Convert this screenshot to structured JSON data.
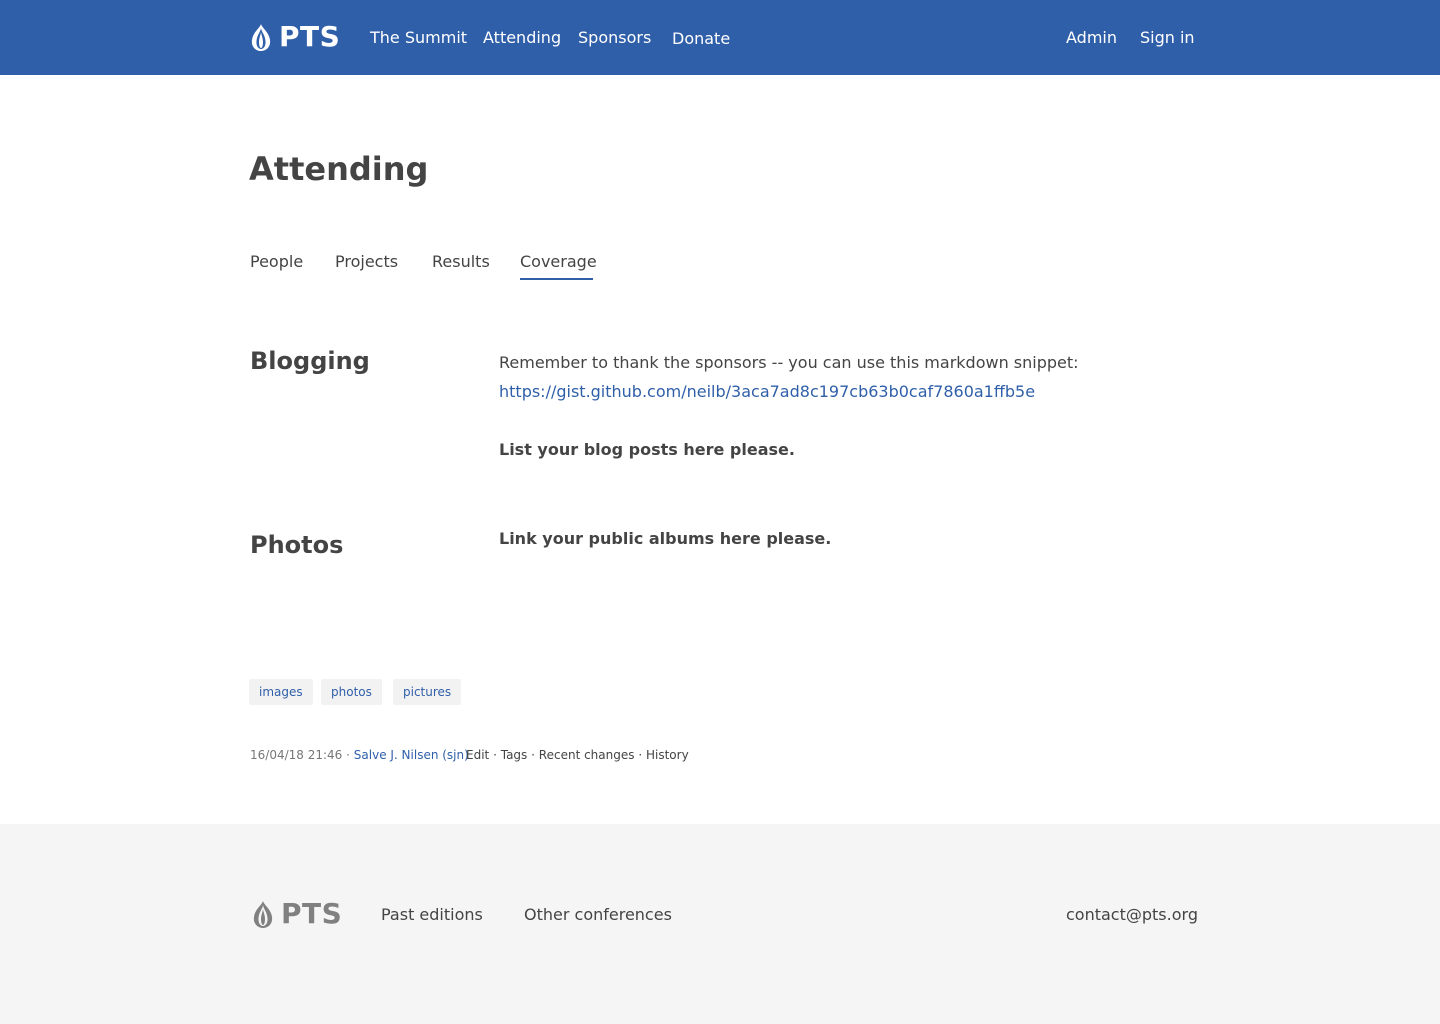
{
  "header": {
    "logo_text": "PTS",
    "nav": [
      "The Summit",
      "Attending",
      "Sponsors",
      "Donate"
    ],
    "right_nav": [
      "Admin",
      "Sign in"
    ]
  },
  "page": {
    "title": "Attending"
  },
  "tabs": {
    "items": [
      "People",
      "Projects",
      "Results",
      "Coverage"
    ],
    "active": "Coverage"
  },
  "sections": {
    "blogging": {
      "heading": "Blogging",
      "text": "Remember to thank the sponsors -- you can use this markdown snippet:",
      "link": "https://gist.github.com/neilb/3aca7ad8c197cb63b0caf7860a1ffb5e",
      "strong": "List your blog posts here please."
    },
    "photos": {
      "heading": "Photos",
      "strong": "Link your public albums here please."
    }
  },
  "tags": [
    "images",
    "photos",
    "pictures"
  ],
  "meta": {
    "timestamp": "16/04/18 21:46",
    "separator": "·",
    "author": "Salve J. Nilsen (sjn)",
    "actions": [
      "Edit",
      "Tags",
      "Recent changes",
      "History"
    ]
  },
  "footer": {
    "logo_text": "PTS",
    "links": [
      "Past editions",
      "Other conferences"
    ],
    "contact": "contact@pts.org"
  },
  "colors": {
    "brand_blue": "#2f5fa9",
    "text": "#444444",
    "footer_bg": "#f5f5f5",
    "tag_bg": "#f2f2f2"
  }
}
